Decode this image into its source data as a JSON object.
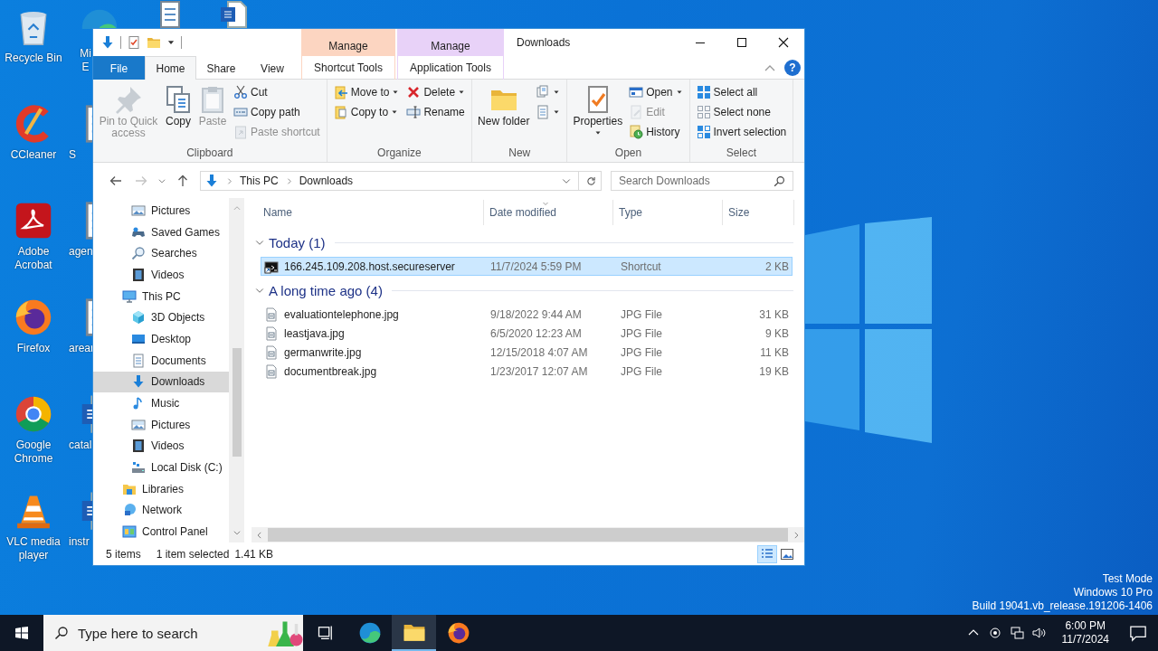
{
  "desktop": {
    "icons": [
      {
        "label": "Recycle Bin"
      },
      {
        "label": "CCleaner"
      },
      {
        "label": "Adobe Acrobat"
      },
      {
        "label": "Firefox"
      },
      {
        "label": "Google Chrome"
      },
      {
        "label": "VLC media player"
      }
    ],
    "covered_icons": [
      {
        "label": "Mi E"
      },
      {
        "label": "S"
      },
      {
        "label": "agen"
      },
      {
        "label": "arear"
      },
      {
        "label": "catal"
      },
      {
        "label": "instr"
      }
    ],
    "system_notice": [
      "Test Mode",
      "Windows 10 Pro",
      "Build 19041.vb_release.191206-1406"
    ]
  },
  "explorer": {
    "title": "Downloads",
    "contextual_tabs": [
      {
        "header": "Manage",
        "label": "Shortcut Tools",
        "color": "#fcd5c1"
      },
      {
        "header": "Manage",
        "label": "Application Tools",
        "color": "#e8d2f8"
      }
    ],
    "tabs": [
      {
        "label": "File",
        "kind": "file",
        "selected": false
      },
      {
        "label": "Home",
        "kind": "tab",
        "selected": true
      },
      {
        "label": "Share",
        "kind": "tab",
        "selected": false
      },
      {
        "label": "View",
        "kind": "tab",
        "selected": false
      }
    ],
    "help_button": "?",
    "ribbon": [
      {
        "label": "Clipboard",
        "columns": [
          [
            {
              "label": "Pin to Quick access",
              "kind": "large",
              "disabled": true,
              "dropdown": false
            }
          ],
          [
            {
              "label": "Copy",
              "kind": "large",
              "disabled": false,
              "dropdown": false
            }
          ],
          [
            {
              "label": "Paste",
              "kind": "large",
              "disabled": true,
              "dropdown": false
            }
          ],
          [
            {
              "label": "Cut",
              "kind": "small",
              "disabled": false,
              "dropdown": false
            },
            {
              "label": "Copy path",
              "kind": "small",
              "disabled": false,
              "dropdown": false
            },
            {
              "label": "Paste shortcut",
              "kind": "small",
              "disabled": true,
              "dropdown": false
            }
          ]
        ]
      },
      {
        "label": "Organize",
        "columns": [
          [
            {
              "label": "Move to",
              "kind": "small",
              "disabled": false,
              "dropdown": true
            },
            {
              "label": "Copy to",
              "kind": "small",
              "disabled": false,
              "dropdown": true
            }
          ],
          [
            {
              "label": "Delete",
              "kind": "small",
              "disabled": false,
              "dropdown": true
            },
            {
              "label": "Rename",
              "kind": "small",
              "disabled": false,
              "dropdown": false
            }
          ]
        ]
      },
      {
        "label": "New",
        "columns": [
          [
            {
              "label": "New folder",
              "kind": "large",
              "disabled": false,
              "dropdown": false
            }
          ],
          [
            {
              "kind": "small",
              "disabled": false,
              "dropdown": true
            },
            {
              "kind": "small",
              "disabled": false,
              "dropdown": true
            }
          ]
        ]
      },
      {
        "label": "Open",
        "columns": [
          [
            {
              "label": "Properties",
              "kind": "large",
              "disabled": false,
              "dropdown": true
            }
          ],
          [
            {
              "label": "Open",
              "kind": "small",
              "disabled": false,
              "dropdown": true
            },
            {
              "label": "Edit",
              "kind": "small",
              "disabled": true,
              "dropdown": false
            },
            {
              "label": "History",
              "kind": "small",
              "disabled": false,
              "dropdown": false
            }
          ]
        ]
      },
      {
        "label": "Select",
        "columns": [
          [
            {
              "label": "Select all",
              "kind": "small",
              "disabled": false,
              "dropdown": false
            },
            {
              "label": "Select none",
              "kind": "small",
              "disabled": false,
              "dropdown": false
            },
            {
              "label": "Invert selection",
              "kind": "small",
              "disabled": false,
              "dropdown": false
            }
          ]
        ]
      }
    ],
    "address": {
      "path": [
        "This PC",
        "Downloads"
      ],
      "search_placeholder": "Search Downloads"
    },
    "navigation_pane": {
      "items": [
        {
          "children": [
            {
              "label": "Pictures",
              "selected": false
            },
            {
              "label": "Saved Games",
              "selected": false
            },
            {
              "label": "Searches",
              "selected": false
            },
            {
              "label": "Videos",
              "selected": false
            }
          ]
        },
        {
          "label": "This PC",
          "selected": false,
          "children": [
            {
              "label": "3D Objects",
              "selected": false
            },
            {
              "label": "Desktop",
              "selected": false
            },
            {
              "label": "Documents",
              "selected": false
            },
            {
              "label": "Downloads",
              "selected": true
            },
            {
              "label": "Music",
              "selected": false
            },
            {
              "label": "Pictures",
              "selected": false
            },
            {
              "label": "Videos",
              "selected": false
            },
            {
              "label": "Local Disk (C:)",
              "selected": false
            }
          ]
        },
        {
          "label": "Libraries",
          "selected": false
        },
        {
          "label": "Network",
          "selected": false
        },
        {
          "label": "Control Panel",
          "selected": false
        }
      ]
    },
    "columns": [
      {
        "label": "Name",
        "sorted": false
      },
      {
        "label": "Date modified",
        "sorted": true
      },
      {
        "label": "Type",
        "sorted": false
      },
      {
        "label": "Size",
        "sorted": false
      }
    ],
    "groups": [
      {
        "label": "Today (1)",
        "expanded": true,
        "files": [
          {
            "name": "166.245.109.208.host.secureserver",
            "date": "11/7/2024 5:59 PM",
            "type": "Shortcut",
            "size": "2 KB",
            "kind": "shortcut",
            "selected": true
          }
        ]
      },
      {
        "label": "A long time ago (4)",
        "expanded": true,
        "files": [
          {
            "name": "evaluationtelephone.jpg",
            "date": "9/18/2022 9:44 AM",
            "type": "JPG File",
            "size": "31 KB",
            "kind": "image",
            "selected": false
          },
          {
            "name": "leastjava.jpg",
            "date": "6/5/2020 12:23 AM",
            "type": "JPG File",
            "size": "9 KB",
            "kind": "image",
            "selected": false
          },
          {
            "name": "germanwrite.jpg",
            "date": "12/15/2018 4:07 AM",
            "type": "JPG File",
            "size": "11 KB",
            "kind": "image",
            "selected": false
          },
          {
            "name": "documentbreak.jpg",
            "date": "1/23/2017 12:07 AM",
            "type": "JPG File",
            "size": "19 KB",
            "kind": "image",
            "selected": false
          }
        ]
      }
    ],
    "status": {
      "item_count": "5 items",
      "selection": "1 item selected",
      "selection_size": "1.41 KB",
      "views": [
        {
          "selected": true
        },
        {
          "selected": false
        }
      ]
    }
  },
  "taskbar": {
    "search": {
      "placeholder": "Type here to search"
    },
    "apps": [
      {
        "selected": false
      },
      {
        "selected": false
      },
      {
        "selected": true
      },
      {
        "selected": false
      }
    ],
    "clock": {
      "time": "6:00 PM",
      "date": "11/7/2024"
    }
  }
}
